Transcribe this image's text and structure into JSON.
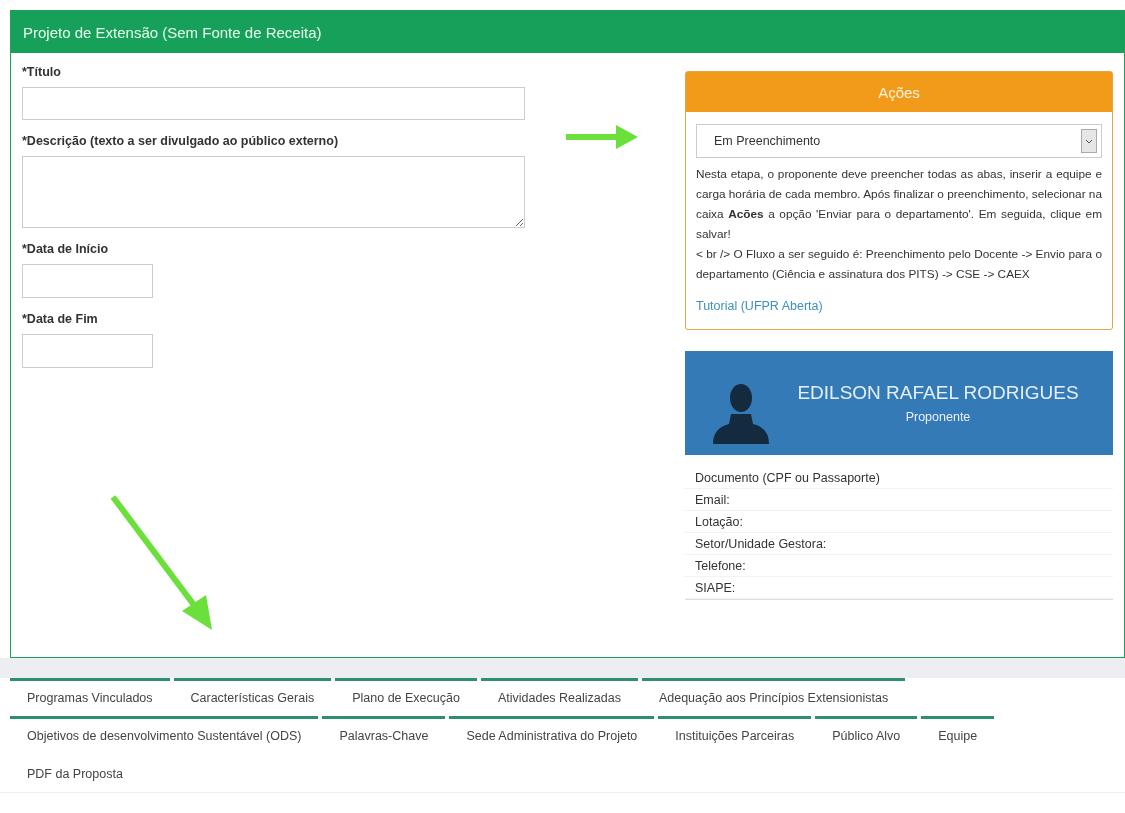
{
  "panel": {
    "title": "Projeto de Extensão (Sem Fonte de Receita)"
  },
  "form": {
    "fields": [
      {
        "label": "*Título",
        "kind": "text"
      },
      {
        "label": "*Descrição (texto a ser divulgado ao público externo)",
        "kind": "textarea"
      },
      {
        "label": "*Data de Início",
        "kind": "date"
      },
      {
        "label": "*Data de Fim",
        "kind": "date"
      }
    ]
  },
  "actions": {
    "title": "Ações",
    "select": {
      "value": "Em Preenchimento"
    },
    "description": "Nesta etapa, o proponente deve preencher todas as abas, inserir a equipe e carga horária de cada membro. Após finalizar o preenchimento, selecionar na caixa **Acões** a opção 'Enviar para o departamento'. Em seguida, clique em salvar!",
    "flow": "< br /> O Fluxo a ser seguido é: Preenchimento pelo Docente -> Envio para o departamento (Ciência e assinatura dos PITS) -> CSE -> CAEX",
    "link": "Tutorial (UFPR Aberta)"
  },
  "profile": {
    "name": "EDILSON RAFAEL RODRIGUES",
    "role": "Proponente",
    "rows": [
      "Documento (CPF ou Passaporte)",
      "Email:",
      "Lotação:",
      "Setor/Unidade Gestora:",
      "Telefone:",
      "SIAPE:"
    ]
  },
  "tabs": [
    [
      {
        "label": "Programas Vinculados",
        "selected": false,
        "kind": "tab"
      },
      {
        "label": "Características Gerais",
        "selected": false,
        "kind": "tab"
      },
      {
        "label": "Plano de Execução",
        "selected": false,
        "kind": "tab"
      },
      {
        "label": "Atividades Realizadas",
        "selected": false,
        "kind": "tab"
      },
      {
        "label": "Adequação aos Princípios Extensionistas",
        "selected": false,
        "kind": "tab"
      }
    ],
    [
      {
        "label": "Objetivos de desenvolvimento Sustentável (ODS)",
        "selected": false,
        "kind": "tab"
      },
      {
        "label": "Palavras-Chave",
        "selected": false,
        "kind": "tab"
      },
      {
        "label": "Sede Administrativa do Projeto",
        "selected": false,
        "kind": "tab"
      },
      {
        "label": "Instituições Parceiras",
        "selected": false,
        "kind": "tab"
      },
      {
        "label": "Público Alvo",
        "selected": false,
        "kind": "tab"
      },
      {
        "label": "Equipe",
        "selected": false,
        "kind": "tab"
      }
    ],
    [
      {
        "label": "PDF da Proposta",
        "selected": false,
        "kind": "plain"
      }
    ]
  ]
}
